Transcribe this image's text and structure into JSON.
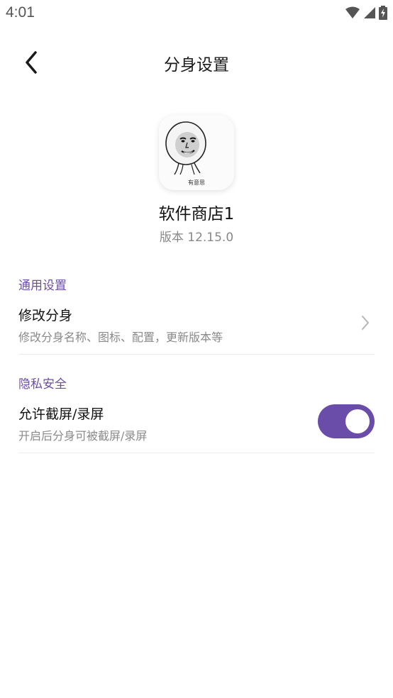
{
  "status_bar": {
    "time": "4:01",
    "icons": [
      "wifi-icon",
      "signal-icon",
      "battery-charging-icon"
    ]
  },
  "header": {
    "back_icon": "chevron-left-icon",
    "title": "分身设置"
  },
  "app": {
    "icon_caption": "有意思",
    "name": "软件商店1",
    "version": "版本 12.15.0"
  },
  "sections": {
    "general": {
      "header": "通用设置",
      "modify_clone": {
        "title": "修改分身",
        "subtitle": "修改分身名称、图标、配置，更新版本等"
      }
    },
    "privacy": {
      "header": "隐私安全",
      "allow_screenshot": {
        "title": "允许截屏/录屏",
        "subtitle": "开启后分身可被截屏/录屏",
        "enabled": true
      }
    }
  },
  "colors": {
    "accent": "#6a4da8",
    "section_header": "#6d4ea5"
  }
}
